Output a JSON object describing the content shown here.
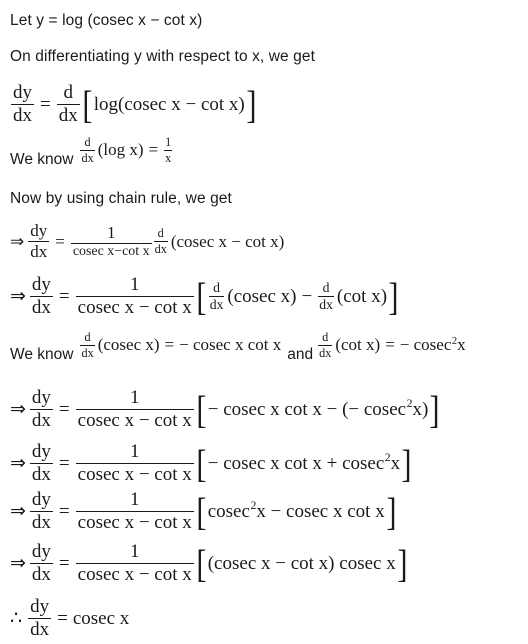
{
  "document": {
    "type": "math-solution",
    "topic": "Differentiation of log(cosec x - cot x)",
    "background_color": "#ffffff",
    "text_color": "#1a1a1a"
  },
  "lines": {
    "line1_let": "Let y = log (cosec x − cot x)",
    "line2_differentiating": "On differentiating y with respect to x, we get",
    "line4_we_know": "We know",
    "line5_chain_rule": "Now by using chain rule, we get",
    "line8_we_know": "We know",
    "line8_and": "and"
  },
  "math": {
    "eq3": {
      "lhs_num": "dy",
      "lhs_den": "dx",
      "equals": "=",
      "op_num": "d",
      "op_den": "dx",
      "bracket_open": "[",
      "body": "log(cosec x − cot x)",
      "bracket_close": "]",
      "body_parts": {
        "log_open": "log(cosec",
        "var1": "x",
        "minus": "−",
        "cot": "cot",
        "var2": "x",
        "close": ")"
      }
    },
    "eq4_inline": {
      "op_num": "d",
      "op_den": "dx",
      "arg": "(log x)",
      "equals": "=",
      "result_num": "1",
      "result_den": "x"
    },
    "eq6": {
      "arrow": "⇒",
      "lhs_num": "dy",
      "lhs_den": "dx",
      "equals": "=",
      "frac_num": "1",
      "frac_den": "cosec x−cot x",
      "op_num": "d",
      "op_den": "dx",
      "arg": "(cosec x − cot x)"
    },
    "eq7": {
      "arrow": "⇒",
      "lhs_num": "dy",
      "lhs_den": "dx",
      "equals": "=",
      "frac_num": "1",
      "frac_den": "cosec x − cot x",
      "bracket_open": "[",
      "term1_op_num": "d",
      "term1_op_den": "dx",
      "term1_arg": "(cosec x)",
      "minus": "−",
      "term2_op_num": "d",
      "term2_op_den": "dx",
      "term2_arg": "(cot x)",
      "bracket_close": "]"
    },
    "eq8_inline_a": {
      "op_num": "d",
      "op_den": "dx",
      "arg": "(cosec x)",
      "equals": "=",
      "result": "− cosec x cot x"
    },
    "eq8_inline_b": {
      "op_num": "d",
      "op_den": "dx",
      "arg": "(cot x)",
      "equals": "=",
      "result_pre": "− cosec",
      "result_exp": "2",
      "result_post": "x"
    },
    "eq9": {
      "arrow": "⇒",
      "lhs_num": "dy",
      "lhs_den": "dx",
      "equals": "=",
      "frac_num": "1",
      "frac_den": "cosec x − cot x",
      "bracket_open": "[",
      "body_pre": "− cosec x cot x − (− cosec",
      "body_exp": "2",
      "body_post": "x)",
      "bracket_close": "]"
    },
    "eq10": {
      "arrow": "⇒",
      "lhs_num": "dy",
      "lhs_den": "dx",
      "equals": "=",
      "frac_num": "1",
      "frac_den": "cosec x − cot x",
      "bracket_open": "[",
      "body_pre": "− cosec x cot x + cosec",
      "body_exp": "2",
      "body_post": "x",
      "bracket_close": "]"
    },
    "eq11": {
      "arrow": "⇒",
      "lhs_num": "dy",
      "lhs_den": "dx",
      "equals": "=",
      "frac_num": "1",
      "frac_den": "cosec x − cot x",
      "bracket_open": "[",
      "body_pre": "cosec",
      "body_exp": "2",
      "body_post": "x − cosec x cot x",
      "bracket_close": "]"
    },
    "eq12": {
      "arrow": "⇒",
      "lhs_num": "dy",
      "lhs_den": "dx",
      "equals": "=",
      "frac_num": "1",
      "frac_den": "cosec x − cot x",
      "bracket_open": "[",
      "body": "(cosec x − cot x) cosec x",
      "bracket_close": "]"
    },
    "eq13": {
      "therefore": "∴",
      "lhs_num": "dy",
      "lhs_den": "dx",
      "equals": "=",
      "rhs": "cosec x"
    }
  }
}
